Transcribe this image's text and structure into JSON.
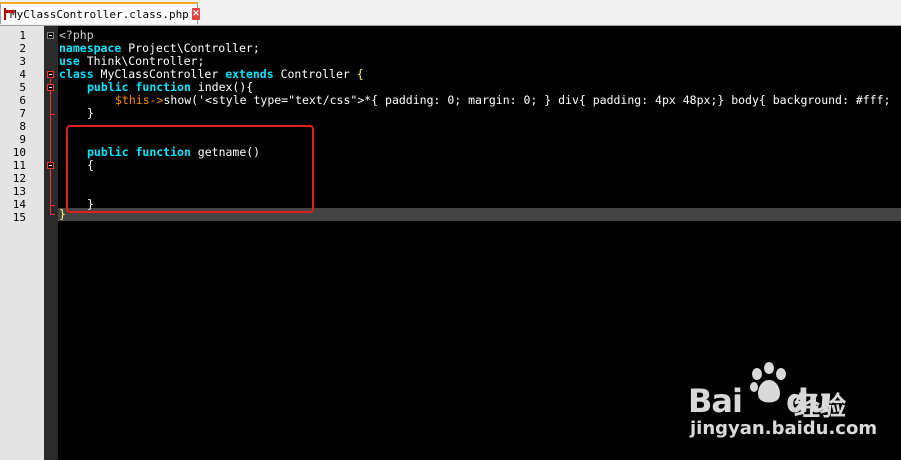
{
  "tab": {
    "filename": "MyClassController.class.php",
    "close_label": "×"
  },
  "line_numbers": [
    "1",
    "2",
    "3",
    "4",
    "5",
    "6",
    "7",
    "8",
    "9",
    "10",
    "11",
    "12",
    "13",
    "14",
    "15"
  ],
  "code": {
    "l1": "<?php",
    "l2_kw": "namespace",
    "l2_rest": " Project\\Controller;",
    "l3_kw": "use",
    "l3_rest": " Think\\Controller;",
    "l4_kw1": "class",
    "l4_name": " MyClassController ",
    "l4_kw2": "extends",
    "l4_parent": " Controller ",
    "l4_brace": "{",
    "l5_kw1": "public",
    "l5_kw2": "function",
    "l5_rest": " index(){",
    "l6_var": "$this->",
    "l6_rest": "show('<style type=\"text/css\">*{ padding: 0; margin: 0; } div{ padding: 4px 48px;} body{ background: #fff;",
    "l7": "}",
    "l10_kw1": "public",
    "l10_kw2": "function",
    "l10_rest": " getname()",
    "l11": "{",
    "l14": "}",
    "l15": "}"
  },
  "watermark": {
    "brand": "Bai",
    "brand2": "du",
    "cn": "经验",
    "url": "jingyan.baidu.com"
  },
  "colors": {
    "keyword": "#00e5ff",
    "variable": "#ff8c00",
    "brace_highlight": "#ffff66",
    "annotation_box": "#e02020"
  },
  "icons": {
    "file": "php-file-icon",
    "close": "close-icon",
    "paw": "baidu-paw-icon"
  }
}
